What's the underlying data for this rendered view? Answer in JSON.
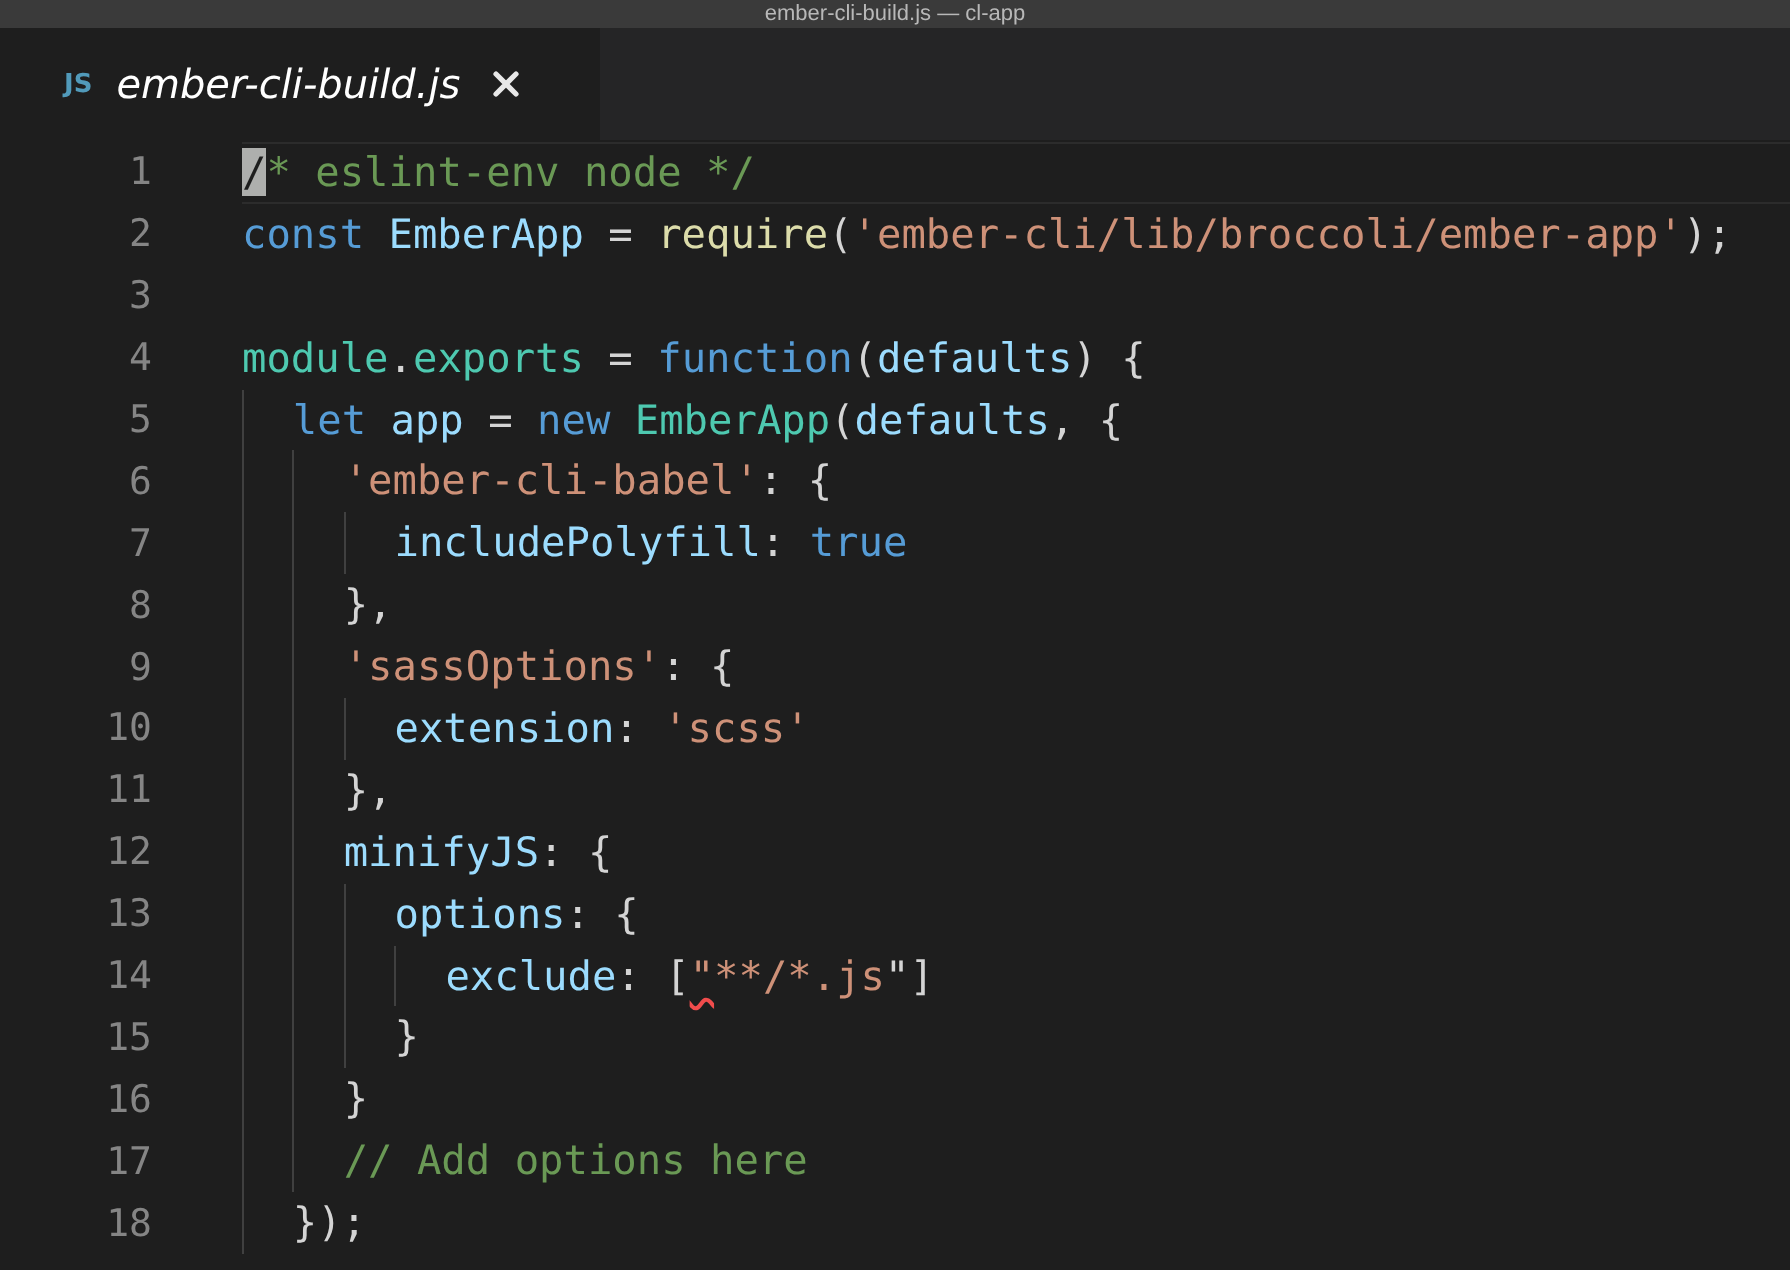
{
  "window": {
    "title": "ember-cli-build.js — cl-app"
  },
  "tabs": [
    {
      "icon_text": "JS",
      "label": "ember-cli-build.js",
      "selected": true
    }
  ],
  "editor": {
    "lines": [
      {
        "number": "1",
        "current": true,
        "tokens": [
          {
            "kind": "cursor",
            "text": "/"
          },
          {
            "kind": "comment",
            "text": "* eslint-env node */"
          }
        ]
      },
      {
        "number": "2",
        "current": false,
        "tokens": [
          {
            "kind": "keyword",
            "text": "const "
          },
          {
            "kind": "variable",
            "text": "EmberApp"
          },
          {
            "kind": "plain",
            "text": " = "
          },
          {
            "kind": "function",
            "text": "require"
          },
          {
            "kind": "plain",
            "text": "("
          },
          {
            "kind": "string",
            "text": "'ember-cli/lib/broccoli/ember-app'"
          },
          {
            "kind": "plain",
            "text": ");"
          }
        ]
      },
      {
        "number": "3",
        "current": false
      },
      {
        "number": "4",
        "current": false,
        "tokens": [
          {
            "kind": "type",
            "text": "module"
          },
          {
            "kind": "plain",
            "text": "."
          },
          {
            "kind": "type",
            "text": "exports"
          },
          {
            "kind": "plain",
            "text": " = "
          },
          {
            "kind": "keyword",
            "text": "function"
          },
          {
            "kind": "plain",
            "text": "("
          },
          {
            "kind": "variable",
            "text": "defaults"
          },
          {
            "kind": "plain",
            "text": ") {"
          }
        ]
      },
      {
        "number": "5",
        "current": false,
        "tokens": [
          {
            "kind": "keyword",
            "text": "  let "
          },
          {
            "kind": "variable",
            "text": "app"
          },
          {
            "kind": "plain",
            "text": " = "
          },
          {
            "kind": "keyword",
            "text": "new "
          },
          {
            "kind": "type",
            "text": "EmberApp"
          },
          {
            "kind": "plain",
            "text": "("
          },
          {
            "kind": "variable",
            "text": "defaults"
          },
          {
            "kind": "plain",
            "text": ", {"
          }
        ]
      },
      {
        "number": "6",
        "current": false,
        "tokens": [
          {
            "kind": "string",
            "text": "    'ember-cli-babel'"
          },
          {
            "kind": "plain",
            "text": ": {"
          }
        ]
      },
      {
        "number": "7",
        "current": false,
        "tokens": [
          {
            "kind": "variable",
            "text": "      includePolyfill"
          },
          {
            "kind": "plain",
            "text": ": "
          },
          {
            "kind": "keyword",
            "text": "true"
          }
        ]
      },
      {
        "number": "8",
        "current": false,
        "tokens": [
          {
            "kind": "plain",
            "text": "    },"
          }
        ]
      },
      {
        "number": "9",
        "current": false,
        "tokens": [
          {
            "kind": "string",
            "text": "    'sassOptions'"
          },
          {
            "kind": "plain",
            "text": ": {"
          }
        ]
      },
      {
        "number": "10",
        "current": false,
        "tokens": [
          {
            "kind": "variable",
            "text": "      extension"
          },
          {
            "kind": "plain",
            "text": ": "
          },
          {
            "kind": "string",
            "text": "'scss'"
          }
        ]
      },
      {
        "number": "11",
        "current": false,
        "tokens": [
          {
            "kind": "plain",
            "text": "    },"
          }
        ]
      },
      {
        "number": "12",
        "current": false,
        "tokens": [
          {
            "kind": "variable",
            "text": "    minifyJS"
          },
          {
            "kind": "plain",
            "text": ": {"
          }
        ]
      },
      {
        "number": "13",
        "current": false,
        "tokens": [
          {
            "kind": "variable",
            "text": "      options"
          },
          {
            "kind": "plain",
            "text": ": {"
          }
        ]
      },
      {
        "number": "14",
        "current": false,
        "tokens": [
          {
            "kind": "variable",
            "text": "        exclude"
          },
          {
            "kind": "plain",
            "text": ": ["
          },
          {
            "kind": "error",
            "text": "\""
          },
          {
            "kind": "string",
            "text": "**/*.js"
          },
          {
            "kind": "plain",
            "text": "\"]"
          }
        ]
      },
      {
        "number": "15",
        "current": false,
        "tokens": [
          {
            "kind": "plain",
            "text": "      }"
          }
        ]
      },
      {
        "number": "16",
        "current": false,
        "tokens": [
          {
            "kind": "plain",
            "text": "    }"
          }
        ]
      },
      {
        "number": "17",
        "current": false,
        "tokens": [
          {
            "kind": "comment",
            "text": "    // Add options here"
          }
        ]
      },
      {
        "number": "18",
        "current": false,
        "tokens": [
          {
            "kind": "plain",
            "text": "  });"
          }
        ]
      }
    ]
  }
}
